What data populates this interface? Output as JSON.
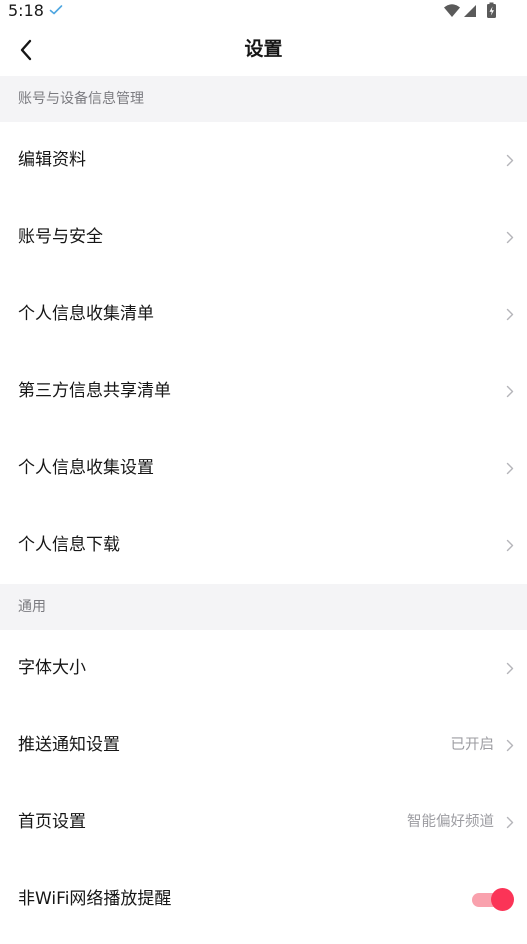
{
  "status_bar": {
    "time": "5:18",
    "icons": [
      "check-icon",
      "wifi-icon",
      "signal-icon",
      "battery-charging-icon"
    ]
  },
  "header": {
    "title": "设置",
    "back_icon": "chevron-left-icon"
  },
  "sections": [
    {
      "title": "账号与设备信息管理",
      "items": [
        {
          "label": "编辑资料"
        },
        {
          "label": "账号与安全"
        },
        {
          "label": "个人信息收集清单"
        },
        {
          "label": "第三方信息共享清单"
        },
        {
          "label": "个人信息收集设置"
        },
        {
          "label": "个人信息下载"
        }
      ]
    },
    {
      "title": "通用",
      "items": [
        {
          "label": "字体大小"
        },
        {
          "label": "推送通知设置",
          "value": "已开启"
        },
        {
          "label": "首页设置",
          "value": "智能偏好频道"
        },
        {
          "label": "非WiFi网络播放提醒",
          "toggle_on": true
        }
      ]
    }
  ],
  "colors": {
    "accent": "#fb3457",
    "accent_track": "#f9a1ad",
    "section_background": "#f4f4f6",
    "secondary_text": "#9d9da2",
    "check_icon": "#4fa6e0"
  }
}
